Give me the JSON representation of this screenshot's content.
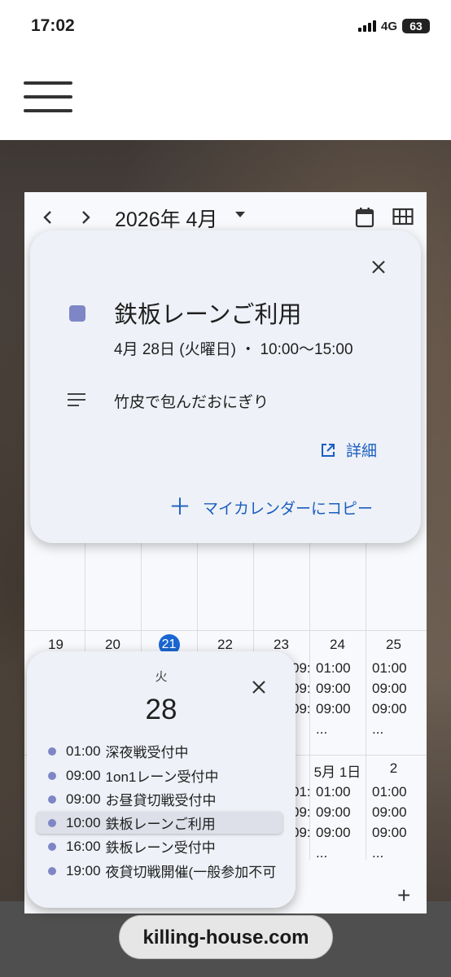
{
  "status_bar": {
    "time": "17:02",
    "network": "4G",
    "battery": "63"
  },
  "calendar": {
    "month_title": "2026年 4月",
    "icons": {
      "prev": "chevron-left-icon",
      "next": "chevron-right-icon",
      "calendar": "calendar-icon",
      "grid": "grid-view-icon",
      "add": "plus-icon"
    },
    "week_row_1": {
      "days": [
        "19",
        "20",
        "21",
        "22",
        "23",
        "24",
        "25"
      ],
      "today_index": 2,
      "col_23_events": [
        "09:00 ",
        "09:00 ",
        "09:00 "
      ],
      "col_24_events": [
        "01:00 ",
        "09:00 ",
        "09:00 ",
        "..."
      ],
      "col_25_events": [
        "01:00 ",
        "09:00 ",
        "09:00 ",
        "..."
      ]
    },
    "week_row_2": {
      "col_30_events": [
        "01:00 ",
        "09:00 ",
        "09:00 "
      ],
      "day_may1": "5月 1日",
      "col_may1_events": [
        "01:00 ",
        "09:00 ",
        "09:00 ",
        "..."
      ],
      "day_2": "2",
      "col_2_events": [
        "01:00 ",
        "09:00 ",
        "09:00 ",
        "..."
      ]
    },
    "add_label": "+"
  },
  "event_popup": {
    "title": "鉄板レーンご利用",
    "time": "4月 28日 (火曜日) ・ 10:00〜15:00",
    "description": "竹皮で包んだおにぎり",
    "details_label": "詳細",
    "copy_label": "マイカレンダーにコピー",
    "color": "#7e86c6"
  },
  "day_popup": {
    "weekday": "火",
    "day": "28",
    "events": [
      {
        "time": "01:00",
        "title": "深夜戦受付中"
      },
      {
        "time": "09:00",
        "title": "1on1レーン受付中"
      },
      {
        "time": "09:00",
        "title": "お昼貸切戦受付中"
      },
      {
        "time": "10:00",
        "title": "鉄板レーンご利用"
      },
      {
        "time": "16:00",
        "title": "鉄板レーン受付中"
      },
      {
        "time": "19:00",
        "title": "夜貸切戦開催(一般参加不可"
      }
    ],
    "selected_index": 3
  },
  "footer": {
    "domain": "killing-house.com"
  }
}
